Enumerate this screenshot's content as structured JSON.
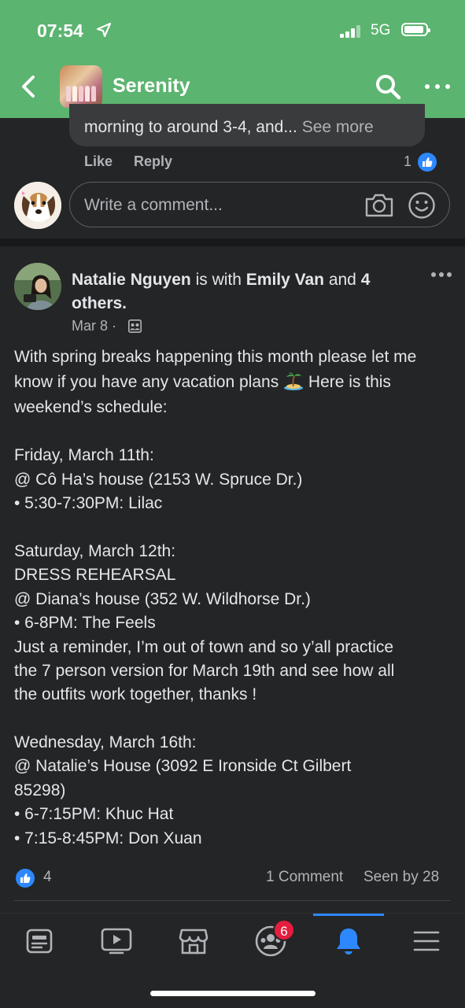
{
  "status_bar": {
    "time": "07:54",
    "network": "5G"
  },
  "header": {
    "group_name": "Serenity"
  },
  "previous_comment": {
    "text": "morning to around 3-4, and...",
    "see_more": "See more",
    "like_label": "Like",
    "reply_label": "Reply",
    "like_count": "1"
  },
  "comment_composer": {
    "placeholder": "Write a comment..."
  },
  "post": {
    "author": "Natalie Nguyen",
    "is_with": "is with",
    "tagged": "Emily Van",
    "and": "and",
    "others": "4 others.",
    "date": "Mar 8",
    "separator": "·",
    "intro_part1": "With spring breaks happening this month please let me know if you have any vacation plans",
    "intro_part2": "Here is this weekend’s schedule:",
    "lines": [
      "Friday, March 11th:",
      "@ Cô Ha’s house (2153 W. Spruce Dr.)",
      "• 5:30-7:30PM: Lilac",
      "",
      "Saturday, March 12th:",
      "DRESS REHEARSAL",
      "@ Diana’s house (352 W. Wildhorse Dr.)",
      "• 6-8PM: The Feels",
      "Just a reminder, I’m out of town and so y’all practice",
      "the 7 person version for March 19th and see how all",
      "the outfits work together, thanks !",
      "",
      "Wednesday, March 16th:",
      "@ Natalie’s House (3092 E Ironside Ct Gilbert",
      "85298)",
      "• 6-7:15PM: Khuc Hat",
      "• 7:15-8:45PM: Don Xuan"
    ],
    "reaction_count": "4",
    "comments_label": "1 Comment",
    "seen_by": "Seen by 28"
  },
  "tabbar": {
    "items": [
      "feed-icon",
      "video-icon",
      "marketplace-icon",
      "groups-icon",
      "notifications-icon",
      "menu-icon"
    ],
    "groups_badge": "6",
    "active": "notifications-icon"
  },
  "colors": {
    "header_green": "#5bb46f",
    "accent_blue": "#2d88ff",
    "badge_red": "#e41e3f",
    "background": "#242526"
  }
}
